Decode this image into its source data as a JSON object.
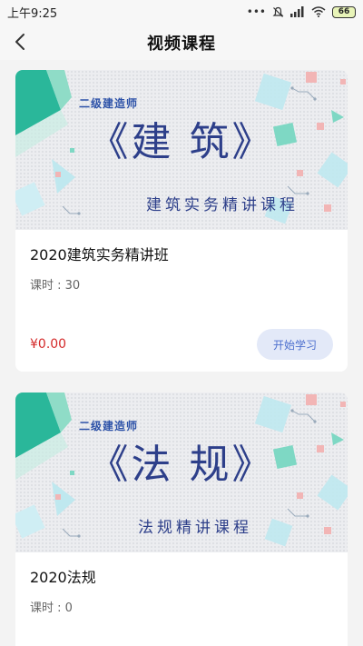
{
  "status_bar": {
    "time": "上午9:25",
    "battery": "66"
  },
  "header": {
    "title": "视频课程"
  },
  "courses": [
    {
      "banner_subtitle": "二级建造师",
      "banner_title": "《建 筑》",
      "banner_caption": "建筑实务精讲课程",
      "name": "2020建筑实务精讲班",
      "hours": "课时 : 30",
      "price": "¥0.00",
      "action": "开始学习"
    },
    {
      "banner_subtitle": "二级建造师",
      "banner_title": "《法 规》",
      "banner_caption": "法规精讲课程",
      "name": "2020法规",
      "hours": "课时 : 0"
    }
  ],
  "colors": {
    "accent": "#4c6fce",
    "price": "#d42a2a",
    "banner_title": "#2d3f8a",
    "teal": "#2ab79a"
  }
}
